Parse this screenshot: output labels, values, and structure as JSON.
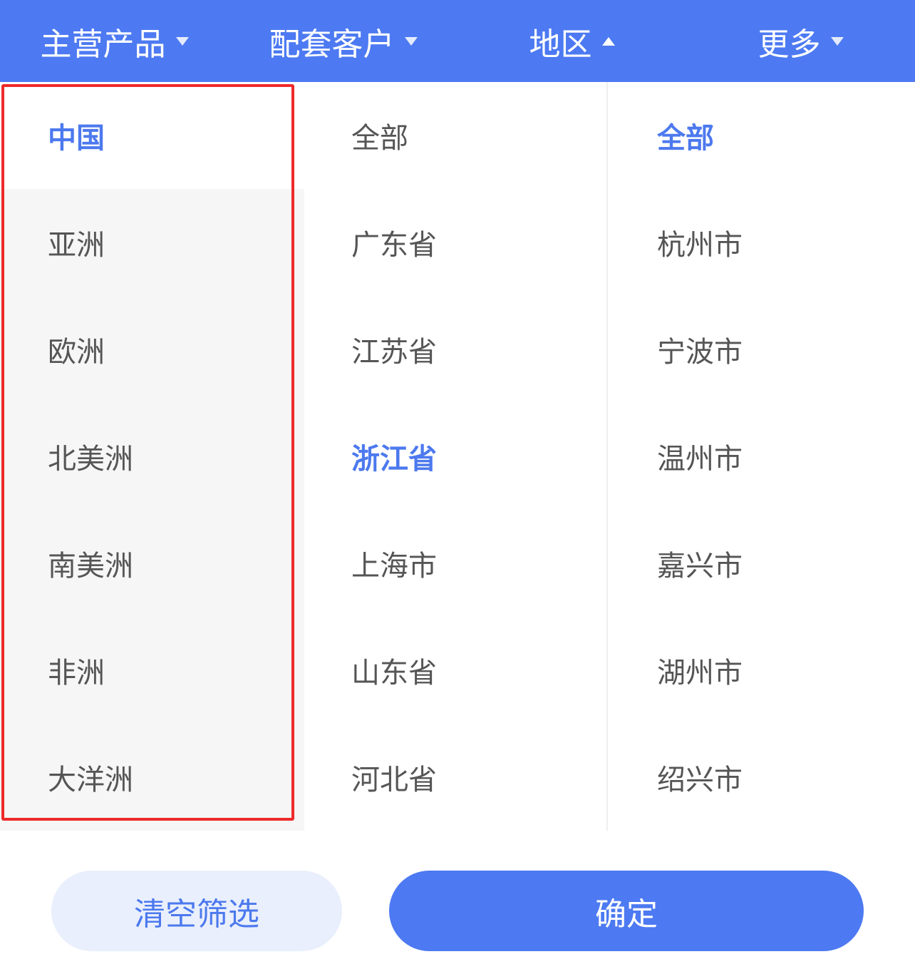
{
  "tabs": [
    {
      "label": "主营产品",
      "state": "collapsed"
    },
    {
      "label": "配套客户",
      "state": "collapsed"
    },
    {
      "label": "地区",
      "state": "expanded"
    },
    {
      "label": "更多",
      "state": "collapsed"
    }
  ],
  "continents": [
    {
      "label": "中国",
      "active": true
    },
    {
      "label": "亚洲",
      "active": false
    },
    {
      "label": "欧洲",
      "active": false
    },
    {
      "label": "北美洲",
      "active": false
    },
    {
      "label": "南美洲",
      "active": false
    },
    {
      "label": "非洲",
      "active": false
    },
    {
      "label": "大洋洲",
      "active": false
    }
  ],
  "provinces": [
    {
      "label": "全部",
      "active": false
    },
    {
      "label": "广东省",
      "active": false
    },
    {
      "label": "江苏省",
      "active": false
    },
    {
      "label": "浙江省",
      "active": true
    },
    {
      "label": "上海市",
      "active": false
    },
    {
      "label": "山东省",
      "active": false
    },
    {
      "label": "河北省",
      "active": false
    }
  ],
  "cities": [
    {
      "label": "全部",
      "active": true
    },
    {
      "label": "杭州市",
      "active": false
    },
    {
      "label": "宁波市",
      "active": false
    },
    {
      "label": "温州市",
      "active": false
    },
    {
      "label": "嘉兴市",
      "active": false
    },
    {
      "label": "湖州市",
      "active": false
    },
    {
      "label": "绍兴市",
      "active": false
    }
  ],
  "buttons": {
    "clear_label": "清空筛选",
    "confirm_label": "确定"
  },
  "colors": {
    "accent": "#4d7af2",
    "active_text": "#4c79ee",
    "highlight_border": "#ee2a2a"
  }
}
